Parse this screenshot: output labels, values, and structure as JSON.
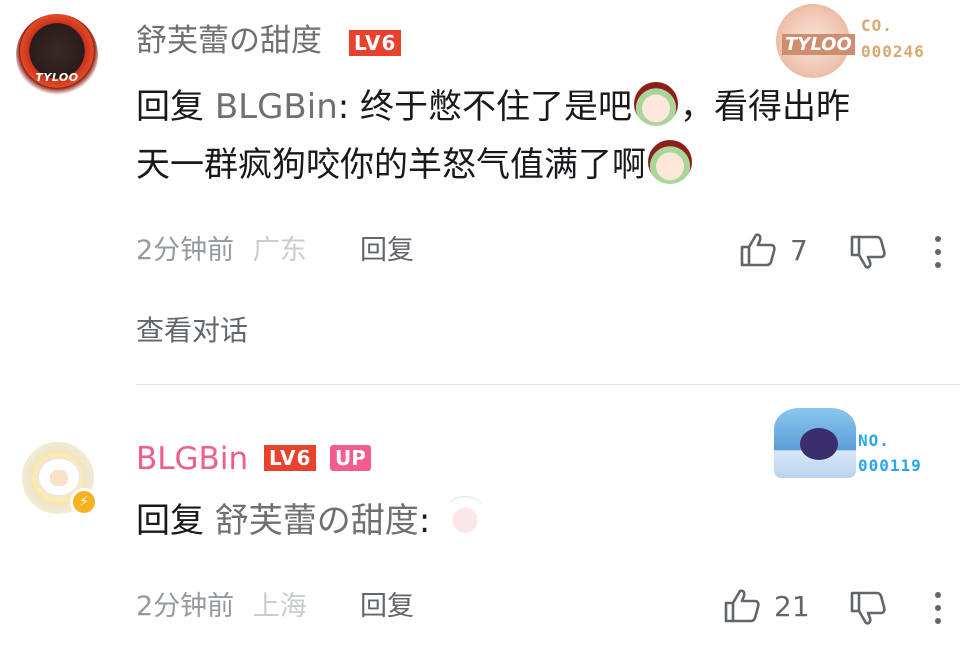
{
  "comments": [
    {
      "avatar_text": "TYLOO",
      "username": "舒芙蕾の甜度",
      "level": "LV6",
      "fan_badge": {
        "logo": "TYLOO",
        "line1": "CO.",
        "line2": "000246"
      },
      "reply_prefix": "回复",
      "mention": "BLGBin",
      "text_line1": ": 终于憋不住了是吧",
      "text_line1_end": "，看得出昨",
      "text_line2": "天一群疯狗咬你的羊怒气值满了啊",
      "time": "2分钟前",
      "location": "广东",
      "reply_label": "回复",
      "like_count": "7",
      "view_conversation": "查看对话"
    },
    {
      "username": "BLGBin",
      "level": "LV6",
      "up_badge": "UP",
      "fan_badge": {
        "line1": "NO.",
        "line2": "000119"
      },
      "reply_prefix": "回复",
      "mention": "舒芙蕾の甜度",
      "text_suffix": ":",
      "time": "2分钟前",
      "location": "上海",
      "reply_label": "回复",
      "like_count": "21"
    }
  ],
  "colors": {
    "username_vip": "#f25d8e",
    "level_badge": "#e8412e",
    "secondary_text": "#9499a0"
  },
  "icons": [
    "thumbs-up-icon",
    "thumbs-down-icon",
    "more-vertical-icon",
    "lightning-icon"
  ]
}
